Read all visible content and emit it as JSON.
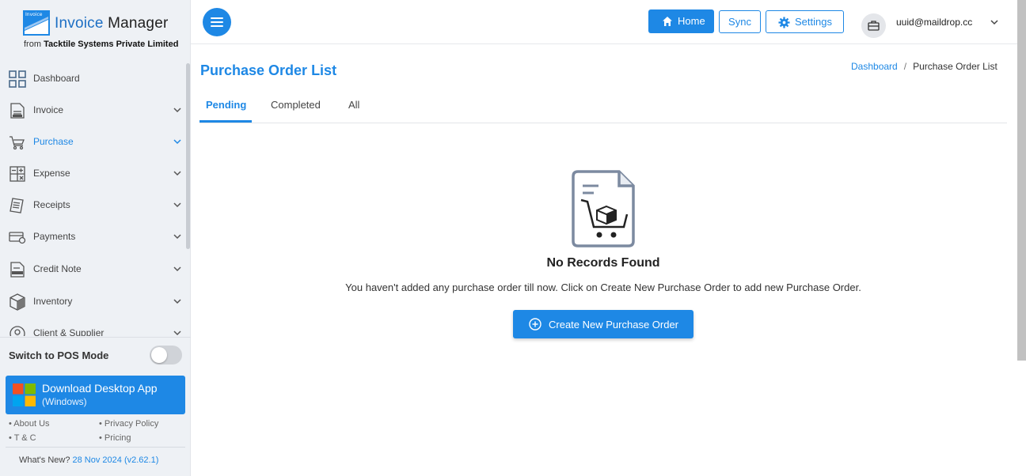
{
  "app": {
    "logo_badge": "Invoice",
    "name_part1": "Invoice",
    "name_part2": "Manager",
    "subtitle_prefix": "from",
    "subtitle_company": "Tacktile Systems Private Limited"
  },
  "sidebar": {
    "items": [
      {
        "label": "Dashboard",
        "icon": "dashboard-grid-icon",
        "has_chevron": false,
        "active": false
      },
      {
        "label": "Invoice",
        "icon": "invoice-icon",
        "has_chevron": true,
        "active": false
      },
      {
        "label": "Purchase",
        "icon": "cart-icon",
        "has_chevron": true,
        "active": true
      },
      {
        "label": "Expense",
        "icon": "calculator-icon",
        "has_chevron": true,
        "active": false
      },
      {
        "label": "Receipts",
        "icon": "receipt-icon",
        "has_chevron": true,
        "active": false
      },
      {
        "label": "Payments",
        "icon": "payment-card-icon",
        "has_chevron": true,
        "active": false
      },
      {
        "label": "Credit Note",
        "icon": "credit-note-icon",
        "has_chevron": true,
        "active": false
      },
      {
        "label": "Inventory",
        "icon": "box-icon",
        "has_chevron": true,
        "active": false
      },
      {
        "label": "Client & Supplier",
        "icon": "contacts-icon",
        "has_chevron": true,
        "active": false
      }
    ],
    "pos_mode_label": "Switch to POS Mode",
    "pos_mode_on": false,
    "download_title": "Download Desktop App",
    "download_sub": "(Windows)",
    "links": {
      "about": "• About Us",
      "privacy": "• Privacy Policy",
      "tc": "• T & C",
      "pricing": "• Pricing"
    },
    "whats_new_label": "What's New?",
    "whats_new_version": "28 Nov 2024 (v2.62.1)"
  },
  "topbar": {
    "home_label": "Home",
    "sync_label": "Sync",
    "settings_label": "Settings",
    "user_email": "uuid@maildrop.cc"
  },
  "page": {
    "title": "Purchase Order List",
    "breadcrumb_root": "Dashboard",
    "breadcrumb_sep": "/",
    "breadcrumb_current": "Purchase Order List",
    "tabs": [
      "Pending",
      "Completed",
      "All"
    ],
    "active_tab": "Pending",
    "empty_title": "No Records Found",
    "empty_message": "You haven't added any purchase order till now. Click on Create New Purchase Order to add new Purchase Order.",
    "create_button_label": "Create New Purchase Order"
  },
  "colors": {
    "accent": "#1e88e5",
    "sidebar_bg": "#eef1f5"
  }
}
